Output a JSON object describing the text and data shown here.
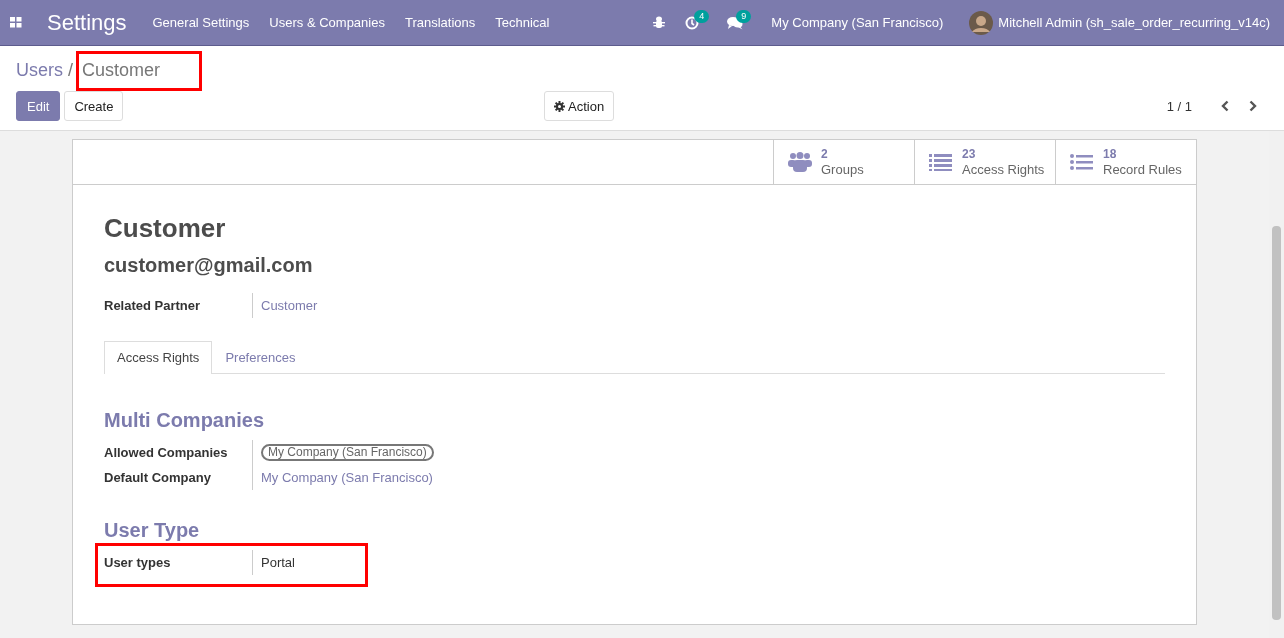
{
  "navbar": {
    "app_title": "Settings",
    "menus": [
      "General Settings",
      "Users & Companies",
      "Translations",
      "Technical"
    ],
    "activity_count": "4",
    "message_count": "9",
    "company": "My Company (San Francisco)",
    "user": "Mitchell Admin (sh_sale_order_recurring_v14c)"
  },
  "breadcrumb": {
    "parent": "Users",
    "separator": "/",
    "current": "Customer",
    "highlighted": true
  },
  "buttons": {
    "edit": "Edit",
    "create": "Create",
    "action": "Action"
  },
  "pager": "1 / 1",
  "smart_buttons": [
    {
      "kind": "groups",
      "count": "2",
      "label": "Groups"
    },
    {
      "kind": "access",
      "count": "23",
      "label": "Access Rights"
    },
    {
      "kind": "rules",
      "count": "18",
      "label": "Record Rules"
    }
  ],
  "form": {
    "name": "Customer",
    "login": "customer@gmail.com",
    "fields": [
      {
        "label": "Related Partner",
        "value": "Customer",
        "kind": "link",
        "highlighted": false
      }
    ],
    "tabs": [
      {
        "label": "Access Rights",
        "selected": true
      },
      {
        "label": "Preferences",
        "selected": false
      }
    ],
    "sections": [
      {
        "title": "Multi Companies",
        "fields": [
          {
            "label": "Allowed Companies",
            "value": "My Company (San Francisco)",
            "kind": "tag",
            "highlighted": false
          },
          {
            "label": "Default Company",
            "value": "My Company (San Francisco)",
            "kind": "link",
            "highlighted": false
          }
        ]
      },
      {
        "title": "User Type",
        "fields": [
          {
            "label": "User types",
            "value": "Portal",
            "kind": "text",
            "highlighted": true
          }
        ]
      }
    ]
  }
}
